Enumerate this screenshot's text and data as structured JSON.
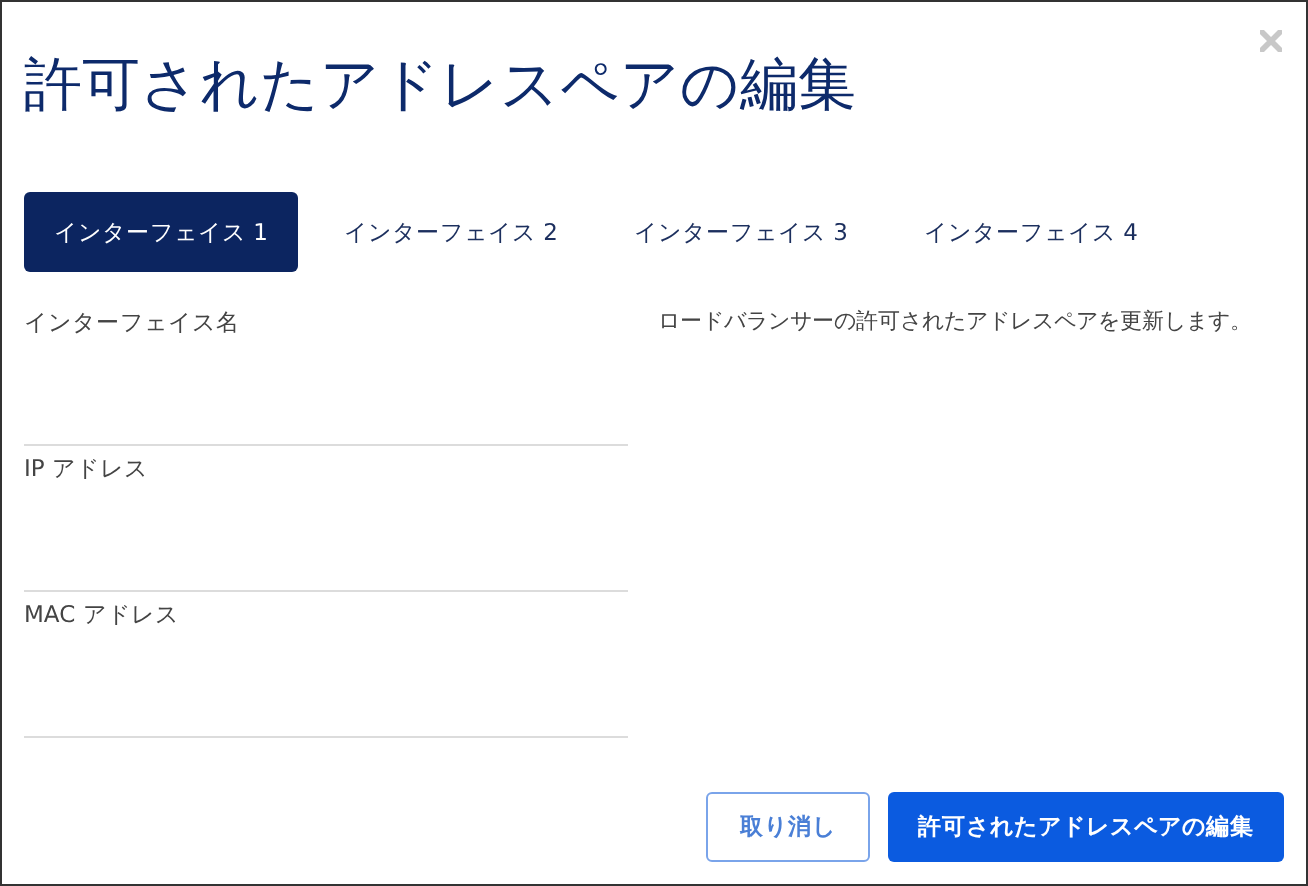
{
  "dialog": {
    "title": "許可されたアドレスペアの編集"
  },
  "tabs": [
    {
      "label": "インターフェイス 1",
      "selected": true
    },
    {
      "label": "インターフェイス 2",
      "selected": false
    },
    {
      "label": "インターフェイス 3",
      "selected": false
    },
    {
      "label": "インターフェイス 4",
      "selected": false
    }
  ],
  "fields": [
    {
      "label": "インターフェイス名"
    },
    {
      "label": "IP アドレス"
    },
    {
      "label": "MAC アドレス"
    }
  ],
  "description": "ロードバランサーの許可されたアドレスペアを更新します。",
  "buttons": [
    {
      "label": "取り消し",
      "kind": "secondary"
    },
    {
      "label": "許可されたアドレスペアの編集",
      "kind": "primary"
    }
  ]
}
